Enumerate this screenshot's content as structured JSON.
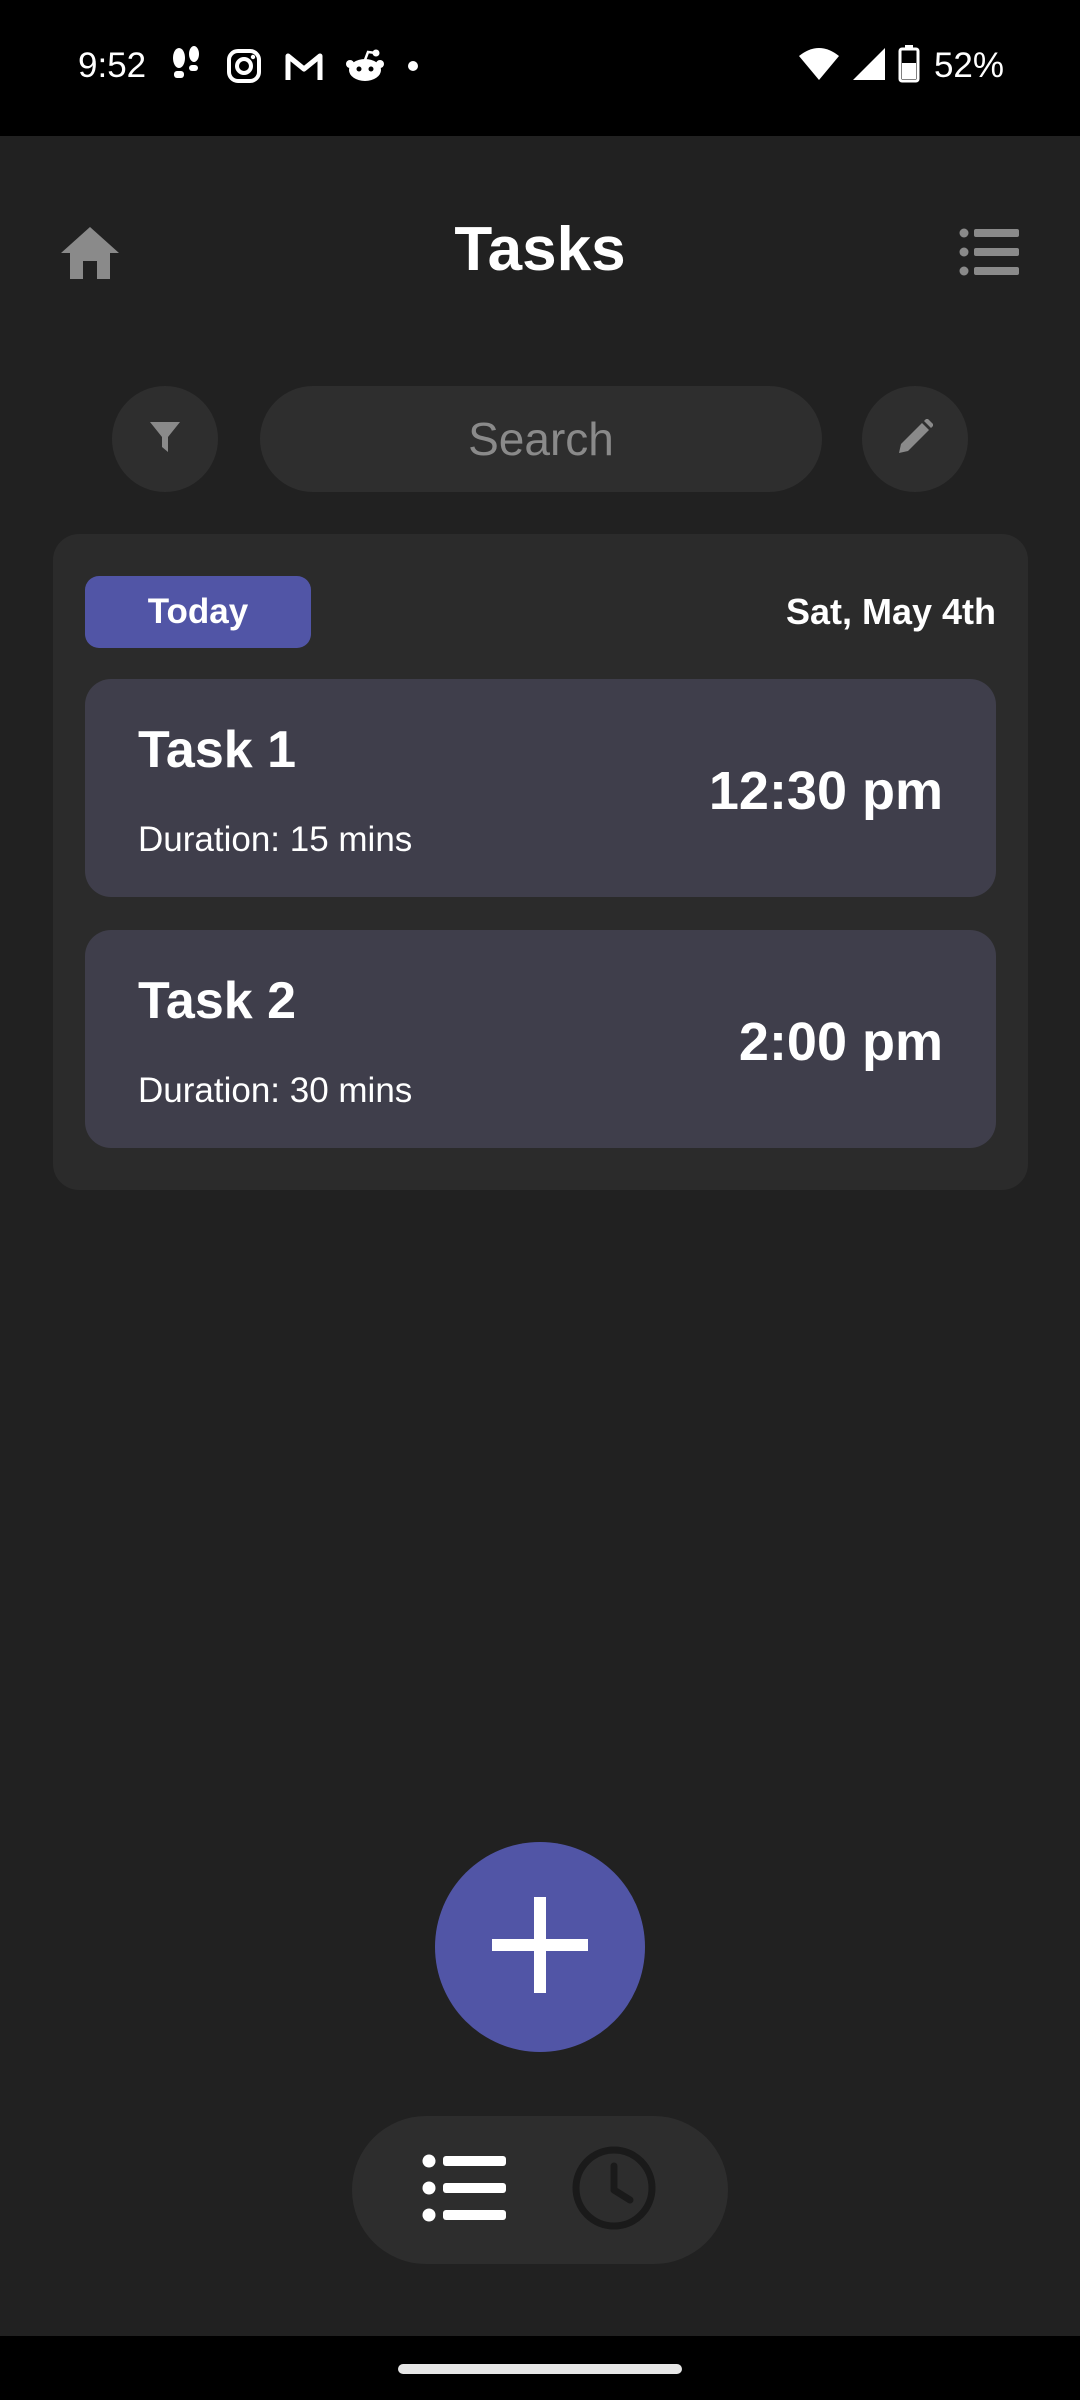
{
  "status_bar": {
    "time": "9:52",
    "battery": "52%",
    "left_icons": [
      "footsteps-icon",
      "instagram-icon",
      "gmail-icon",
      "reddit-icon",
      "dot-icon"
    ],
    "right_icons": [
      "wifi-icon",
      "signal-icon",
      "battery-icon"
    ]
  },
  "header": {
    "title": "Tasks",
    "left_icon": "home-icon",
    "right_icon": "list-menu-icon"
  },
  "search": {
    "placeholder": "Search",
    "value": "",
    "filter_icon": "filter-icon",
    "edit_icon": "edit-icon"
  },
  "day_group": {
    "badge": "Today",
    "date": "Sat, May 4th",
    "tasks": [
      {
        "name": "Task 1",
        "duration": "Duration: 15 mins",
        "time": "12:30 pm"
      },
      {
        "name": "Task 2",
        "duration": "Duration: 30 mins",
        "time": "2:00 pm"
      }
    ]
  },
  "fab": {
    "icon": "plus-icon"
  },
  "bottom_nav": {
    "items": [
      {
        "icon": "list-icon",
        "active": true
      },
      {
        "icon": "clock-icon",
        "active": false
      }
    ]
  },
  "colors": {
    "background": "#212121",
    "panel": "#2b2b2b",
    "card": "#3f3e4b",
    "accent": "#5155a6",
    "icon_gray": "#8a8a8a"
  }
}
